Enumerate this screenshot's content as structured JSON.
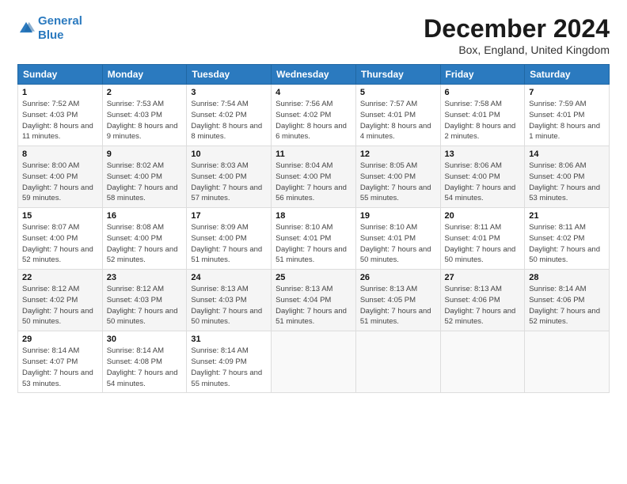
{
  "header": {
    "logo_line1": "General",
    "logo_line2": "Blue",
    "title": "December 2024",
    "subtitle": "Box, England, United Kingdom"
  },
  "days_of_week": [
    "Sunday",
    "Monday",
    "Tuesday",
    "Wednesday",
    "Thursday",
    "Friday",
    "Saturday"
  ],
  "weeks": [
    [
      {
        "day": 1,
        "sunrise": "7:52 AM",
        "sunset": "4:03 PM",
        "daylight": "8 hours and 11 minutes."
      },
      {
        "day": 2,
        "sunrise": "7:53 AM",
        "sunset": "4:03 PM",
        "daylight": "8 hours and 9 minutes."
      },
      {
        "day": 3,
        "sunrise": "7:54 AM",
        "sunset": "4:02 PM",
        "daylight": "8 hours and 8 minutes."
      },
      {
        "day": 4,
        "sunrise": "7:56 AM",
        "sunset": "4:02 PM",
        "daylight": "8 hours and 6 minutes."
      },
      {
        "day": 5,
        "sunrise": "7:57 AM",
        "sunset": "4:01 PM",
        "daylight": "8 hours and 4 minutes."
      },
      {
        "day": 6,
        "sunrise": "7:58 AM",
        "sunset": "4:01 PM",
        "daylight": "8 hours and 2 minutes."
      },
      {
        "day": 7,
        "sunrise": "7:59 AM",
        "sunset": "4:01 PM",
        "daylight": "8 hours and 1 minute."
      }
    ],
    [
      {
        "day": 8,
        "sunrise": "8:00 AM",
        "sunset": "4:00 PM",
        "daylight": "7 hours and 59 minutes."
      },
      {
        "day": 9,
        "sunrise": "8:02 AM",
        "sunset": "4:00 PM",
        "daylight": "7 hours and 58 minutes."
      },
      {
        "day": 10,
        "sunrise": "8:03 AM",
        "sunset": "4:00 PM",
        "daylight": "7 hours and 57 minutes."
      },
      {
        "day": 11,
        "sunrise": "8:04 AM",
        "sunset": "4:00 PM",
        "daylight": "7 hours and 56 minutes."
      },
      {
        "day": 12,
        "sunrise": "8:05 AM",
        "sunset": "4:00 PM",
        "daylight": "7 hours and 55 minutes."
      },
      {
        "day": 13,
        "sunrise": "8:06 AM",
        "sunset": "4:00 PM",
        "daylight": "7 hours and 54 minutes."
      },
      {
        "day": 14,
        "sunrise": "8:06 AM",
        "sunset": "4:00 PM",
        "daylight": "7 hours and 53 minutes."
      }
    ],
    [
      {
        "day": 15,
        "sunrise": "8:07 AM",
        "sunset": "4:00 PM",
        "daylight": "7 hours and 52 minutes."
      },
      {
        "day": 16,
        "sunrise": "8:08 AM",
        "sunset": "4:00 PM",
        "daylight": "7 hours and 52 minutes."
      },
      {
        "day": 17,
        "sunrise": "8:09 AM",
        "sunset": "4:00 PM",
        "daylight": "7 hours and 51 minutes."
      },
      {
        "day": 18,
        "sunrise": "8:10 AM",
        "sunset": "4:01 PM",
        "daylight": "7 hours and 51 minutes."
      },
      {
        "day": 19,
        "sunrise": "8:10 AM",
        "sunset": "4:01 PM",
        "daylight": "7 hours and 50 minutes."
      },
      {
        "day": 20,
        "sunrise": "8:11 AM",
        "sunset": "4:01 PM",
        "daylight": "7 hours and 50 minutes."
      },
      {
        "day": 21,
        "sunrise": "8:11 AM",
        "sunset": "4:02 PM",
        "daylight": "7 hours and 50 minutes."
      }
    ],
    [
      {
        "day": 22,
        "sunrise": "8:12 AM",
        "sunset": "4:02 PM",
        "daylight": "7 hours and 50 minutes."
      },
      {
        "day": 23,
        "sunrise": "8:12 AM",
        "sunset": "4:03 PM",
        "daylight": "7 hours and 50 minutes."
      },
      {
        "day": 24,
        "sunrise": "8:13 AM",
        "sunset": "4:03 PM",
        "daylight": "7 hours and 50 minutes."
      },
      {
        "day": 25,
        "sunrise": "8:13 AM",
        "sunset": "4:04 PM",
        "daylight": "7 hours and 51 minutes."
      },
      {
        "day": 26,
        "sunrise": "8:13 AM",
        "sunset": "4:05 PM",
        "daylight": "7 hours and 51 minutes."
      },
      {
        "day": 27,
        "sunrise": "8:13 AM",
        "sunset": "4:06 PM",
        "daylight": "7 hours and 52 minutes."
      },
      {
        "day": 28,
        "sunrise": "8:14 AM",
        "sunset": "4:06 PM",
        "daylight": "7 hours and 52 minutes."
      }
    ],
    [
      {
        "day": 29,
        "sunrise": "8:14 AM",
        "sunset": "4:07 PM",
        "daylight": "7 hours and 53 minutes."
      },
      {
        "day": 30,
        "sunrise": "8:14 AM",
        "sunset": "4:08 PM",
        "daylight": "7 hours and 54 minutes."
      },
      {
        "day": 31,
        "sunrise": "8:14 AM",
        "sunset": "4:09 PM",
        "daylight": "7 hours and 55 minutes."
      },
      null,
      null,
      null,
      null
    ]
  ]
}
